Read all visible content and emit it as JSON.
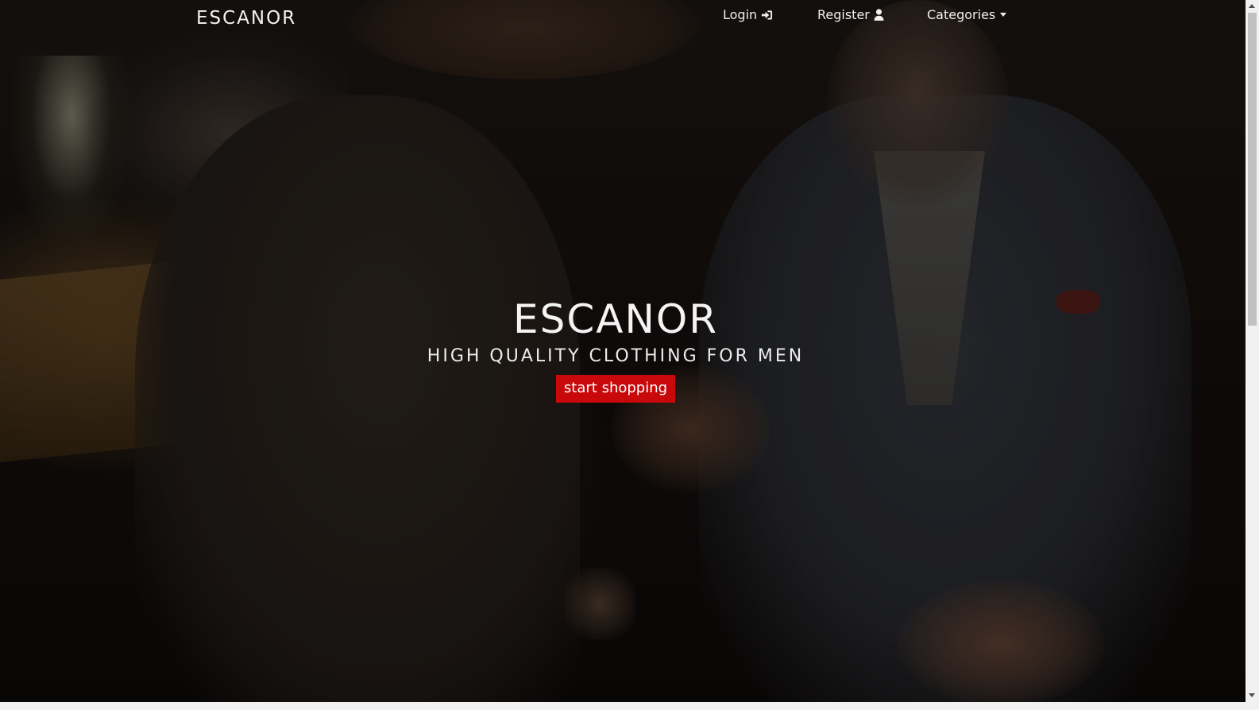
{
  "navbar": {
    "brand": "ESCANOR",
    "login_label": "Login",
    "register_label": "Register",
    "categories_label": "Categories"
  },
  "hero": {
    "title": "ESCANOR",
    "subtitle": "HIGH QUALITY CLOTHING FOR MEN",
    "cta_label": "start shopping"
  },
  "icons": {
    "login": "sign-in-icon",
    "register": "user-icon",
    "categories": "caret-down-icon"
  },
  "colors": {
    "cta_background": "#c8080b",
    "text": "#f4f4f4",
    "overlay": "#000000"
  }
}
